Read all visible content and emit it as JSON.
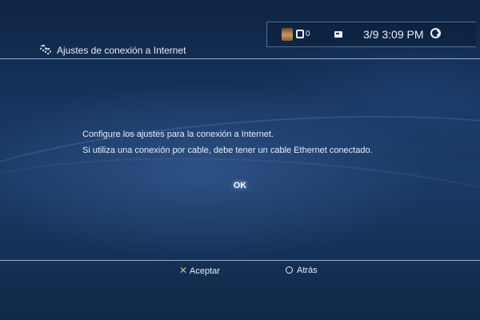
{
  "status_bar": {
    "friends_count": "0",
    "date": "3/9",
    "time": "3:09 PM",
    "icons": [
      "avatar",
      "friends-icon",
      "message-icon",
      "clock-icon"
    ]
  },
  "header": {
    "title": "Ajustes de conexión a Internet",
    "icon": "settings-gear-icon"
  },
  "dialog": {
    "line1": "Configure los ajustes para la conexión a Internet.",
    "line2": "Si utiliza una conexión por cable, debe tener un cable Ethernet conectado.",
    "ok_label": "OK"
  },
  "footer": {
    "accept_label": "Aceptar",
    "back_label": "Atrás",
    "accept_icon": "cross-button-icon",
    "back_icon": "circle-button-icon"
  },
  "colors": {
    "background": "#173560",
    "text": "#e8edf5",
    "rule": "#c8d7f0"
  }
}
